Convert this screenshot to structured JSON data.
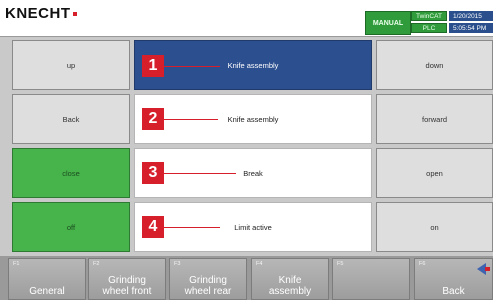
{
  "header": {
    "logo": "KNECHT",
    "mode": "MANUAL",
    "twincat": "TwinCAT",
    "plc": "PLC",
    "date": "1/20/2015",
    "time": "5:05:54 PM"
  },
  "left_buttons": [
    "up",
    "Back",
    "close",
    "off"
  ],
  "center_rows": [
    "Knife assembly",
    "Knife assembly",
    "Break",
    "Limit active"
  ],
  "markers": [
    "1",
    "2",
    "3",
    "4"
  ],
  "right_buttons": [
    "down",
    "forward",
    "open",
    "on"
  ],
  "fkeys": [
    {
      "no": "F1",
      "label": "General"
    },
    {
      "no": "F2",
      "label": "Grinding\nwheel front"
    },
    {
      "no": "F3",
      "label": "Grinding\nwheel rear"
    },
    {
      "no": "F4",
      "label": "Knife\nassembly"
    },
    {
      "no": "F5",
      "label": ""
    },
    {
      "no": "F6",
      "label": "Back"
    }
  ],
  "colors": {
    "active_row": "#2c4f8f",
    "green_button": "#46b34b",
    "marker_red": "#d61f2a",
    "status_green": "#2f9b3b",
    "datetime_blue": "#2b4f8c"
  }
}
